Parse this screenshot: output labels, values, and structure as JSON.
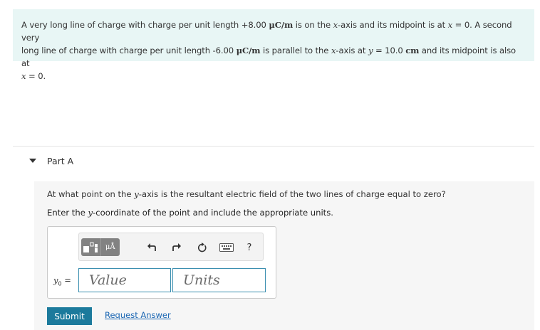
{
  "problem": {
    "s1": "A very long line of charge with charge per unit length +8.00 ",
    "unit1": "μC/m",
    "s2": " is on the ",
    "x1": "x",
    "s3": "-axis and its midpoint is at ",
    "x2": "x",
    "s4": " = 0. A second very",
    "s5": "long line of charge with charge per unit length -6.00 ",
    "unit2": "μC/m",
    "s6": " is parallel to the ",
    "x3": "x",
    "s7": "-axis at ",
    "y1": "y",
    "s8": " = 10.0 ",
    "unit3": "cm",
    "s9": " and its midpoint is also at",
    "x4": "x",
    "s10": " = 0."
  },
  "part": {
    "title": "Part A",
    "q_pre": "At what point on the ",
    "q_var": "y",
    "q_post": "-axis is the resultant electric field of the two lines of charge equal to zero?",
    "i_pre": "Enter the ",
    "i_var": "y",
    "i_post": "-coordinate of the point and include the appropriate units."
  },
  "toolbar": {
    "units_glyph": "μÅ",
    "help_label": "?"
  },
  "answer": {
    "var_label": "y",
    "var_sub": "0",
    "equals": " =",
    "value_placeholder": "Value",
    "units_placeholder": "Units"
  },
  "actions": {
    "submit": "Submit",
    "request": "Request Answer"
  },
  "colors": {
    "problem_bg": "#e8f6f5",
    "accent": "#1c7a9c",
    "link": "#1a66b3",
    "field_border": "#3b8fb0"
  }
}
